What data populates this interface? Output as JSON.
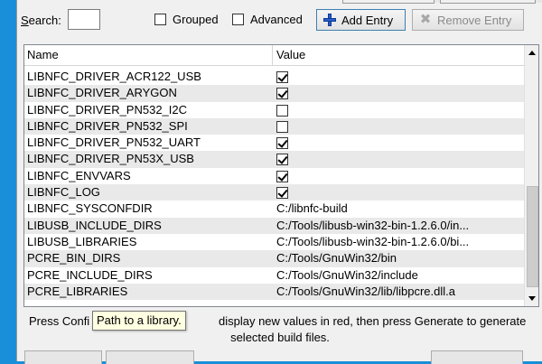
{
  "toolbar": {
    "search_label": "Search:",
    "search_value": "",
    "grouped_label": "Grouped",
    "advanced_label": "Advanced",
    "add_entry_label": "Add Entry",
    "remove_entry_label": "Remove Entry"
  },
  "table": {
    "columns": [
      "Name",
      "Value"
    ],
    "rows": [
      {
        "name": "LIBNFC_DRIVER_ACR122_USB",
        "type": "bool",
        "checked": true
      },
      {
        "name": "LIBNFC_DRIVER_ARYGON",
        "type": "bool",
        "checked": true
      },
      {
        "name": "LIBNFC_DRIVER_PN532_I2C",
        "type": "bool",
        "checked": false
      },
      {
        "name": "LIBNFC_DRIVER_PN532_SPI",
        "type": "bool",
        "checked": false
      },
      {
        "name": "LIBNFC_DRIVER_PN532_UART",
        "type": "bool",
        "checked": true
      },
      {
        "name": "LIBNFC_DRIVER_PN53X_USB",
        "type": "bool",
        "checked": true
      },
      {
        "name": "LIBNFC_ENVVARS",
        "type": "bool",
        "checked": true
      },
      {
        "name": "LIBNFC_LOG",
        "type": "bool",
        "checked": true
      },
      {
        "name": "LIBNFC_SYSCONFDIR",
        "type": "text",
        "value": "C:/libnfc-build"
      },
      {
        "name": "LIBUSB_INCLUDE_DIRS",
        "type": "text",
        "value": "C:/Tools/libusb-win32-bin-1.2.6.0/in..."
      },
      {
        "name": "LIBUSB_LIBRARIES",
        "type": "text",
        "value": "C:/Tools/libusb-win32-bin-1.2.6.0/bi..."
      },
      {
        "name": "PCRE_BIN_DIRS",
        "type": "text",
        "value": "C:/Tools/GnuWin32/bin"
      },
      {
        "name": "PCRE_INCLUDE_DIRS",
        "type": "text",
        "value": "C:/Tools/GnuWin32/include"
      },
      {
        "name": "PCRE_LIBRARIES",
        "type": "text",
        "value": "C:/Tools/GnuWin32/lib/libpcre.dll.a"
      }
    ]
  },
  "status": {
    "line1_start": "Press Confi",
    "line1_end": "display new values in red, then press Generate to generate",
    "line2": "selected build files."
  },
  "tooltip": {
    "text": "Path to a library."
  },
  "colors": {
    "desktop": "#1a8fd9",
    "window": "#f0f0f0",
    "alt_row": "#e9e9e9",
    "tooltip_bg": "#ffffe1"
  }
}
